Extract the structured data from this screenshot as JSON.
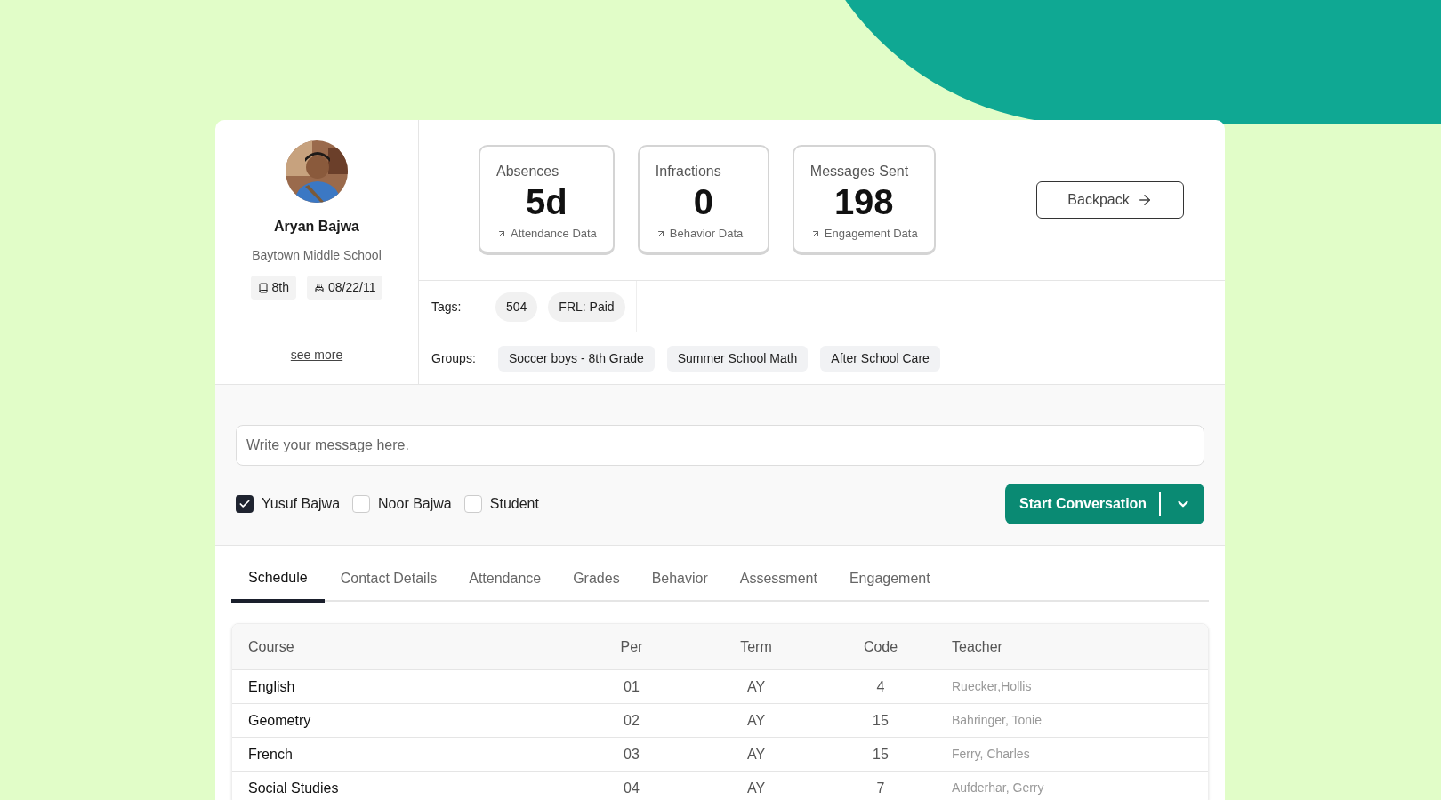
{
  "profile": {
    "name": "Aryan Bajwa",
    "school": "Baytown Middle School",
    "grade": "8th",
    "birthday": "08/22/11",
    "see_more": "see more"
  },
  "stats": [
    {
      "label": "Absences",
      "value": "5d",
      "link": "Attendance Data"
    },
    {
      "label": "Infractions",
      "value": "0",
      "link": "Behavior Data"
    },
    {
      "label": "Messages Sent",
      "value": "198",
      "link": "Engagement Data"
    }
  ],
  "backpack_button": "Backpack",
  "tags": {
    "label": "Tags:",
    "items": [
      "504",
      "FRL: Paid"
    ]
  },
  "groups": {
    "label": "Groups:",
    "items": [
      "Soccer boys - 8th Grade",
      "Summer School Math",
      "After School Care"
    ]
  },
  "message": {
    "placeholder": "Write your message here."
  },
  "recipients": [
    {
      "name": "Yusuf Bajwa",
      "checked": true
    },
    {
      "name": "Noor Bajwa",
      "checked": false
    },
    {
      "name": "Student",
      "checked": false
    }
  ],
  "start_button": "Start Conversation",
  "tabs": [
    {
      "label": "Schedule",
      "selected": true
    },
    {
      "label": "Contact Details",
      "selected": false
    },
    {
      "label": "Attendance",
      "selected": false
    },
    {
      "label": "Grades",
      "selected": false
    },
    {
      "label": "Behavior",
      "selected": false
    },
    {
      "label": "Assessment",
      "selected": false
    },
    {
      "label": "Engagement",
      "selected": false
    }
  ],
  "table": {
    "columns": [
      "Course",
      "Per",
      "Term",
      "Code",
      "Teacher"
    ],
    "rows": [
      [
        "English",
        "01",
        "AY",
        "4",
        "Ruecker,Hollis"
      ],
      [
        "Geometry",
        "02",
        "AY",
        "15",
        "Bahringer, Tonie"
      ],
      [
        "French",
        "03",
        "AY",
        "15",
        "Ferry, Charles"
      ],
      [
        "Social Studies",
        "04",
        "AY",
        "7",
        "Aufderhar, Gerry"
      ]
    ]
  }
}
